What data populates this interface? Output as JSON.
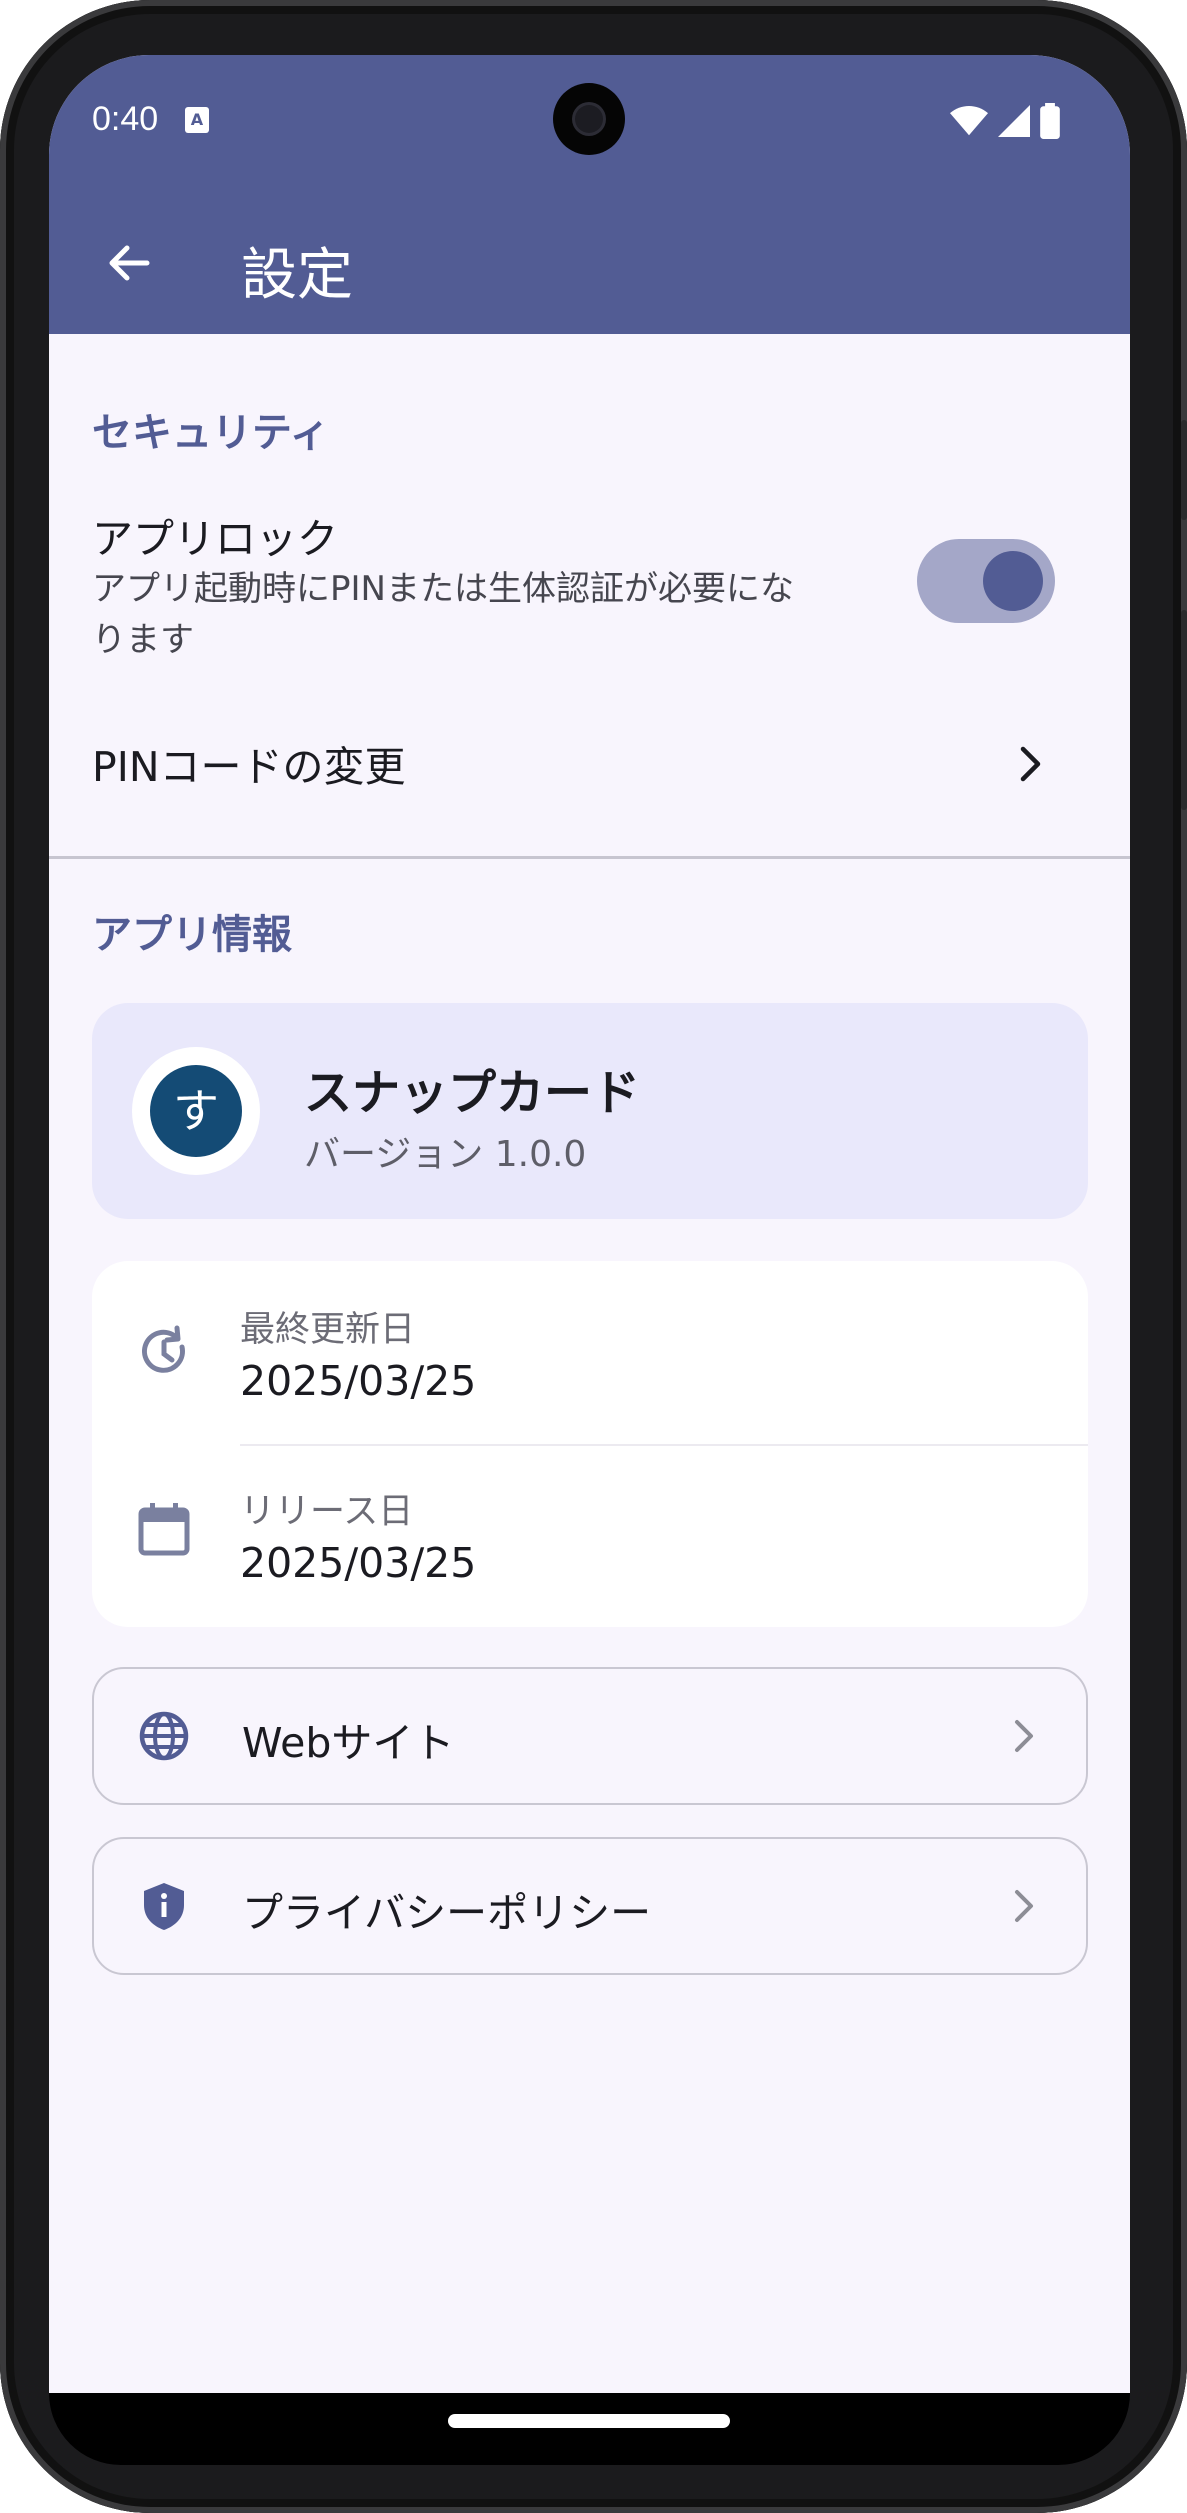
{
  "status_bar": {
    "time": "0:40",
    "notification_icon": "A"
  },
  "app_bar": {
    "title": "設定"
  },
  "security": {
    "header": "セキュリティ",
    "app_lock_title": "アプリロック",
    "app_lock_desc_line1": "アプリ起動時にPINまたは生体認証が必要にな",
    "app_lock_desc_line2": "ります",
    "app_lock_enabled": true,
    "change_pin_label": "PINコードの変更"
  },
  "app_info": {
    "header": "アプリ情報",
    "logo_char": "す",
    "app_name": "スナップカード",
    "version": "バージョン 1.0.0",
    "last_updated_label": "最終更新日",
    "last_updated_value": "2025/03/25",
    "release_label": "リリース日",
    "release_value": "2025/03/25",
    "website_label": "Webサイト",
    "privacy_label": "プライバシーポリシー"
  },
  "colors": {
    "primary": "#525c94",
    "surface": "#f8f5fd",
    "card_tint": "#e9e8fb",
    "logo_bg": "#144b75"
  }
}
